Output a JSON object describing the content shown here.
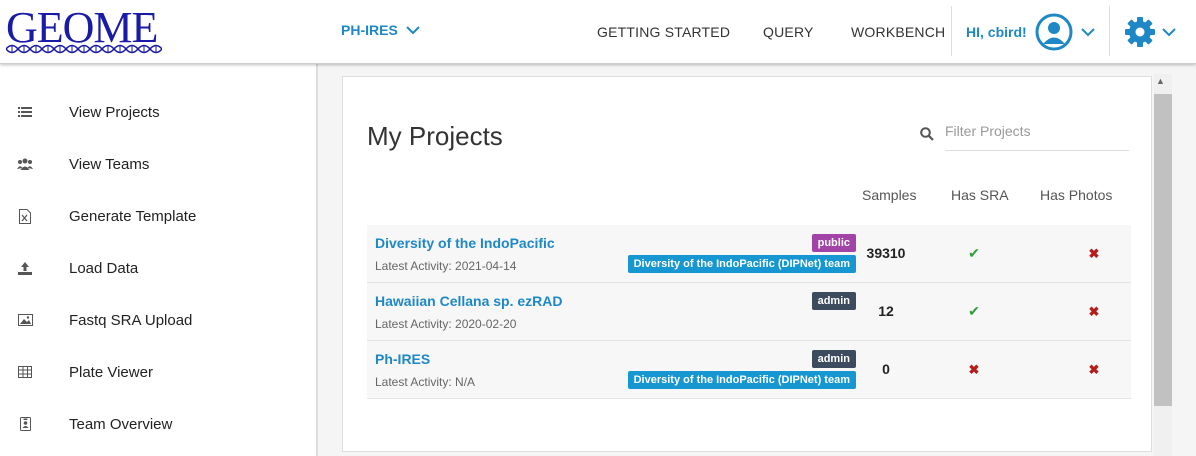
{
  "header": {
    "logo_text": "GEOME",
    "project_selector": "PH-IRES",
    "nav": [
      "GETTING STARTED",
      "QUERY",
      "WORKBENCH"
    ],
    "user_greeting": "HI, cbird!"
  },
  "sidebar": {
    "items": [
      {
        "label": "View Projects",
        "icon": "list-icon"
      },
      {
        "label": "View Teams",
        "icon": "users-icon"
      },
      {
        "label": "Generate Template",
        "icon": "excel-file-icon"
      },
      {
        "label": "Load Data",
        "icon": "upload-icon"
      },
      {
        "label": "Fastq SRA Upload",
        "icon": "image-icon"
      },
      {
        "label": "Plate Viewer",
        "icon": "table-icon"
      },
      {
        "label": "Team Overview",
        "icon": "badge-icon"
      }
    ]
  },
  "main": {
    "title": "My Projects",
    "filter_placeholder": "Filter Projects",
    "columns": {
      "samples": "Samples",
      "sra": "Has SRA",
      "photos": "Has Photos"
    },
    "projects": [
      {
        "name": "Diversity of the IndoPacific",
        "activity": "Latest Activity: 2021-04-14",
        "badge": "public",
        "team": "Diversity of the IndoPacific (DIPNet) team",
        "samples": "39310",
        "has_sra": true,
        "has_photos": false
      },
      {
        "name": "Hawaiian Cellana sp. ezRAD",
        "activity": "Latest Activity: 2020-02-20",
        "badge": "admin",
        "team": "",
        "samples": "12",
        "has_sra": true,
        "has_photos": false
      },
      {
        "name": "Ph-IRES",
        "activity": "Latest Activity: N/A",
        "badge": "admin",
        "team": "Diversity of the IndoPacific (DIPNet) team",
        "samples": "0",
        "has_sra": false,
        "has_photos": false
      }
    ]
  },
  "colors": {
    "accent": "#1e88c7",
    "public_badge": "#a243a7",
    "admin_badge": "#3d4b5e",
    "team_badge": "#1797d1",
    "check": "#2e9d3a",
    "cross": "#b71c1c"
  }
}
